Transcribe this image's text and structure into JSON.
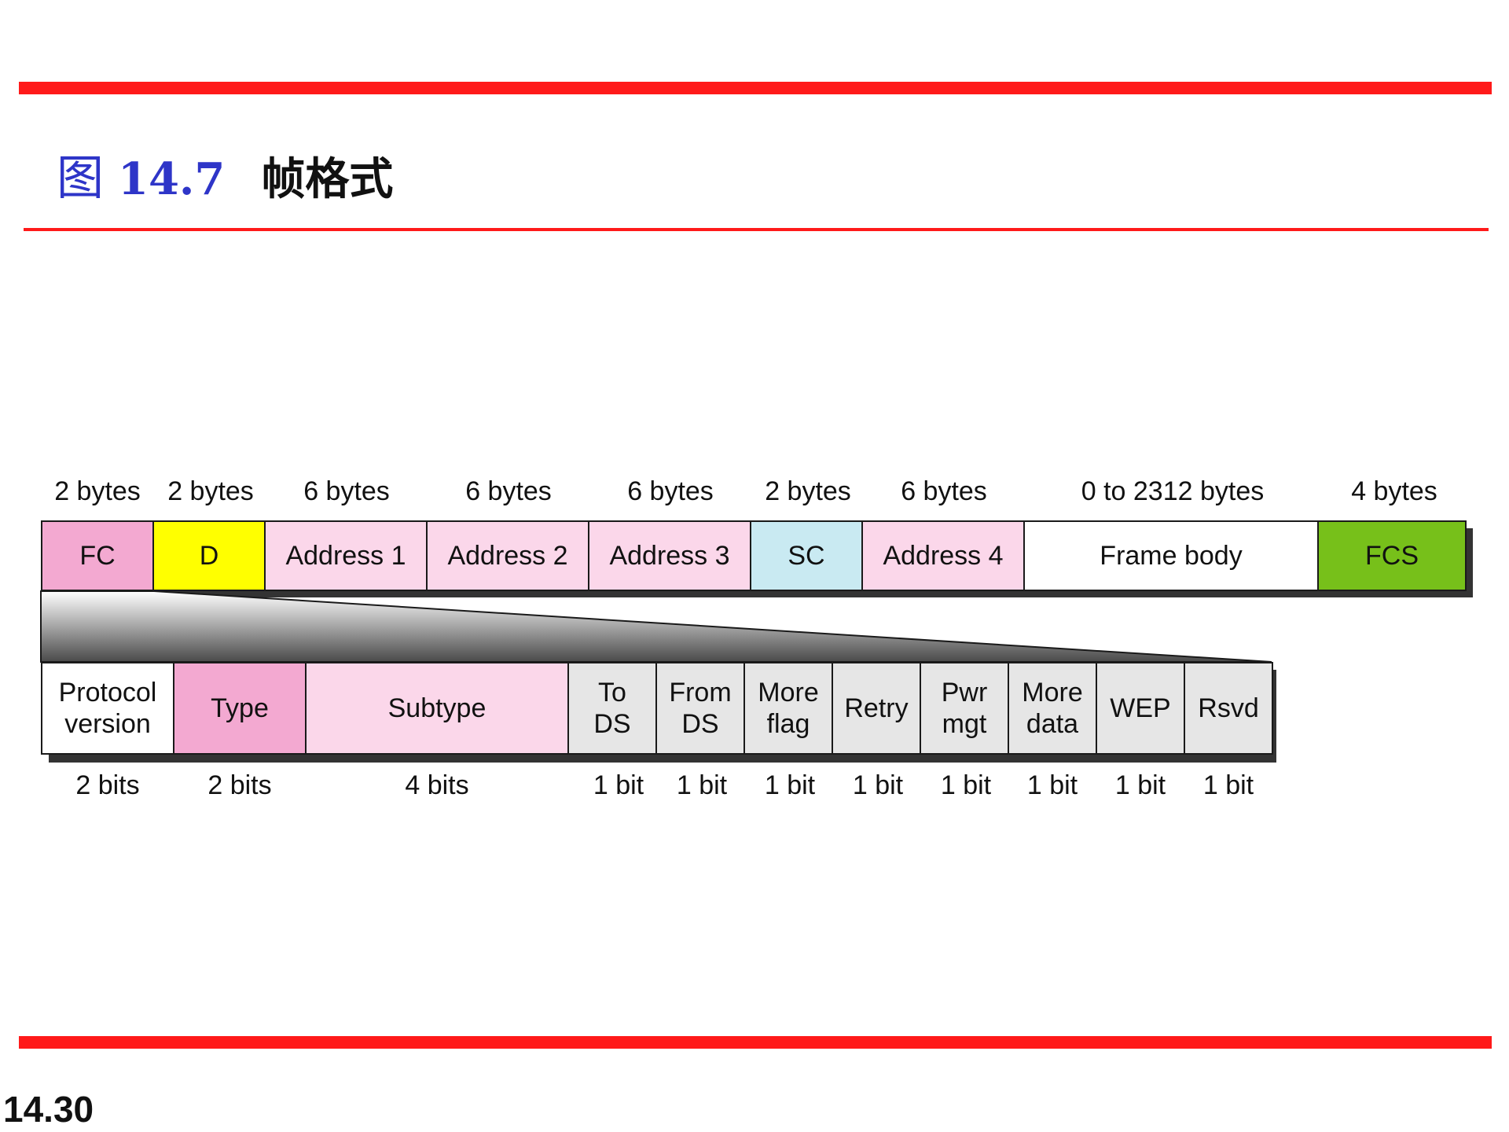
{
  "header": {
    "figure_prefix": "图",
    "figure_number": "14.7",
    "figure_title": "帧格式"
  },
  "page_number": "14.30",
  "colors": {
    "rule": "#ff1a1a",
    "title_blue": "#2e35c8",
    "fc": "#f3a9d1",
    "duration": "#ffff00",
    "address": "#fbd7ea",
    "sc": "#c9eaf2",
    "frame_body": "#ffffff",
    "fcs": "#77c01a",
    "flag": "#e6e6e6"
  },
  "frame": {
    "sizes": [
      "2 bytes",
      "2 bytes",
      "6 bytes",
      "6 bytes",
      "6 bytes",
      "2 bytes",
      "6 bytes",
      "0 to 2312 bytes",
      "4 bytes"
    ],
    "fields": [
      {
        "label": "FC"
      },
      {
        "label": "D"
      },
      {
        "label": "Address 1"
      },
      {
        "label": "Address 2"
      },
      {
        "label": "Address 3"
      },
      {
        "label": "SC"
      },
      {
        "label": "Address 4"
      },
      {
        "label": "Frame body"
      },
      {
        "label": "FCS"
      }
    ]
  },
  "fc_subfields": {
    "fields": [
      {
        "line1": "Protocol",
        "line2": "version"
      },
      {
        "line1": "Type",
        "line2": ""
      },
      {
        "line1": "Subtype",
        "line2": ""
      },
      {
        "line1": "To",
        "line2": "DS"
      },
      {
        "line1": "From",
        "line2": "DS"
      },
      {
        "line1": "More",
        "line2": "flag"
      },
      {
        "line1": "Retry",
        "line2": ""
      },
      {
        "line1": "Pwr",
        "line2": "mgt"
      },
      {
        "line1": "More",
        "line2": "data"
      },
      {
        "line1": "WEP",
        "line2": ""
      },
      {
        "line1": "Rsvd",
        "line2": ""
      }
    ],
    "sizes": [
      "2 bits",
      "2 bits",
      "4 bits",
      "1 bit",
      "1 bit",
      "1 bit",
      "1 bit",
      "1 bit",
      "1 bit",
      "1 bit",
      "1 bit"
    ]
  }
}
